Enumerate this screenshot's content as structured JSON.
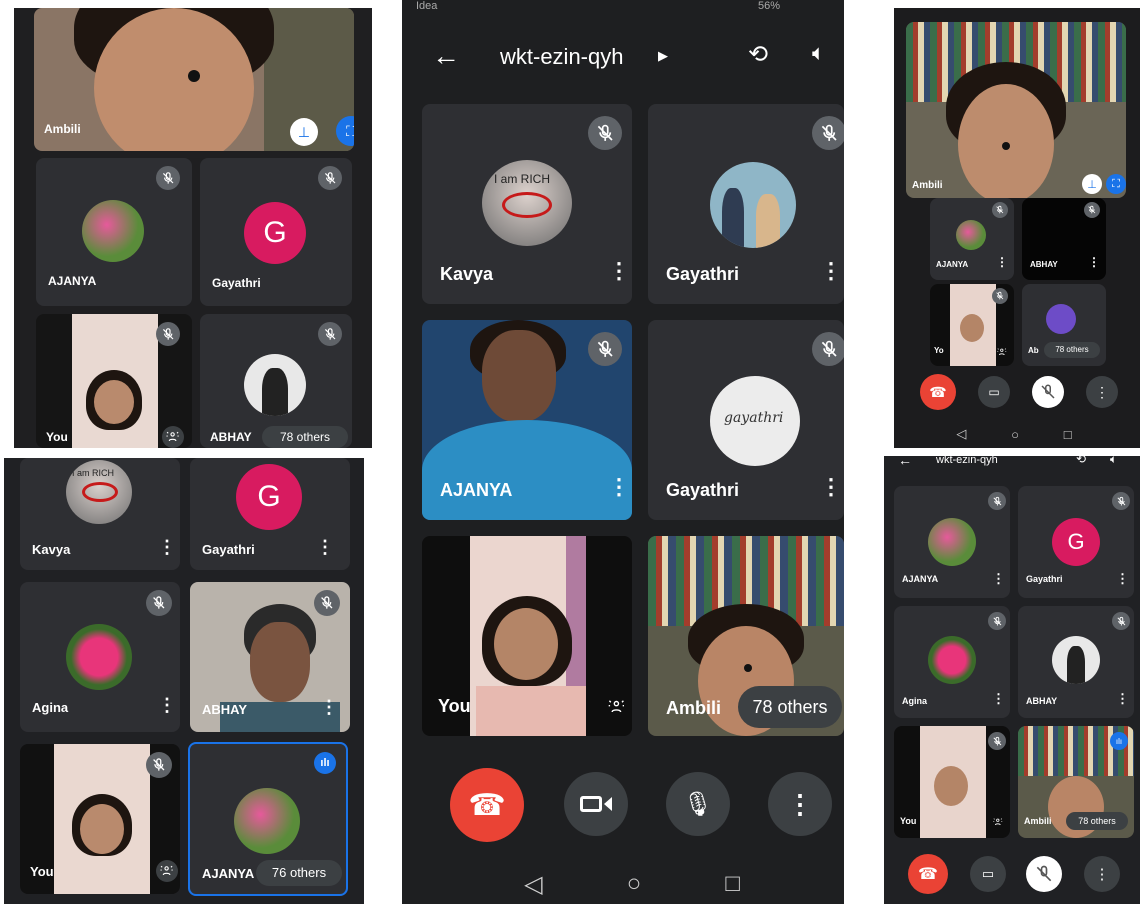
{
  "meeting_code": "wkt-ezin-qyh",
  "participants": {
    "ambili": "Ambili",
    "ajanya": "AJANYA",
    "gayathri": "Gayathri",
    "you": "You",
    "abhay": "ABHAY",
    "kavya": "Kavya",
    "agina": "Agina",
    "ab_short": "Ab",
    "you_short": "Yo"
  },
  "others": {
    "count_78": "78 others",
    "count_76": "76 others"
  },
  "avatar_letters": {
    "gayathri": "G"
  },
  "avatar_text": {
    "kavya": "I am RICH",
    "gayathri_art": "gayathri"
  },
  "status_bar": {
    "left": "Idea",
    "right": "56%"
  },
  "icons": {
    "back": "arrow-left-icon",
    "rotate": "camera-switch-icon",
    "speaker": "speaker-icon",
    "mic_off": "mic-off-icon",
    "more": "more-vert-icon",
    "pin": "pin-icon",
    "fullscreen": "fullscreen-icon",
    "end_call": "end-call-icon",
    "camera": "camera-icon",
    "mic": "mic-icon",
    "captions": "captions-icon",
    "audio_active": "audio-wave-icon",
    "nav_back": "nav-back-icon",
    "nav_home": "nav-home-icon",
    "nav_recents": "nav-recents-icon"
  },
  "colors": {
    "background": "#202124",
    "tile": "#2e2f33",
    "end_call": "#ea4335",
    "gayathri_avatar": "#d81b60",
    "active_speaker": "#1a73e8"
  }
}
